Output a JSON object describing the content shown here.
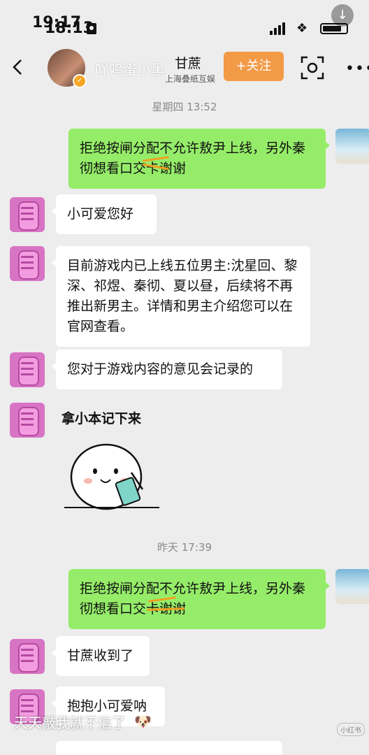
{
  "status_bar": {
    "time_a": "19:17",
    "time_b": "18:13"
  },
  "header": {
    "back_icon": "chevron-left",
    "name": "吖呜蛋小黑",
    "contact_name": "甘蔗",
    "company": "上海叠纸互娱",
    "follow_label": "+关注",
    "scan_icon": "scan",
    "more_icon": "more-dots"
  },
  "chat": {
    "time_1": "星期四 13:52",
    "msg_1": "拒绝按闸分配不允许敖尹上线，另外秦彻想看口交卡谢谢",
    "msg_2": "小可爱您好",
    "msg_3": "目前游戏内已上线五位男主:沈星回、黎深、祁煜、秦彻、夏以昼，后续将不再推出新男主。详情和男主介绍您可以在官网查看。",
    "msg_4": "您对于游戏内容的意见会记录的",
    "sticker_caption": "拿小本记下来",
    "time_2": "昨天 17:39",
    "msg_5": "拒绝按闸分配不允许敖尹上线，另外秦彻想看口交卡谢谢",
    "msg_6": "甘蔗收到了",
    "msg_7": "抱抱小可爱呐"
  },
  "overlay": {
    "text": "天天敲我就不信了",
    "watermark": "小红书"
  },
  "colors": {
    "background": "#ededed",
    "bubble_self": "#95ec69",
    "bubble_other": "#ffffff",
    "follow_button": "#f39a47"
  }
}
